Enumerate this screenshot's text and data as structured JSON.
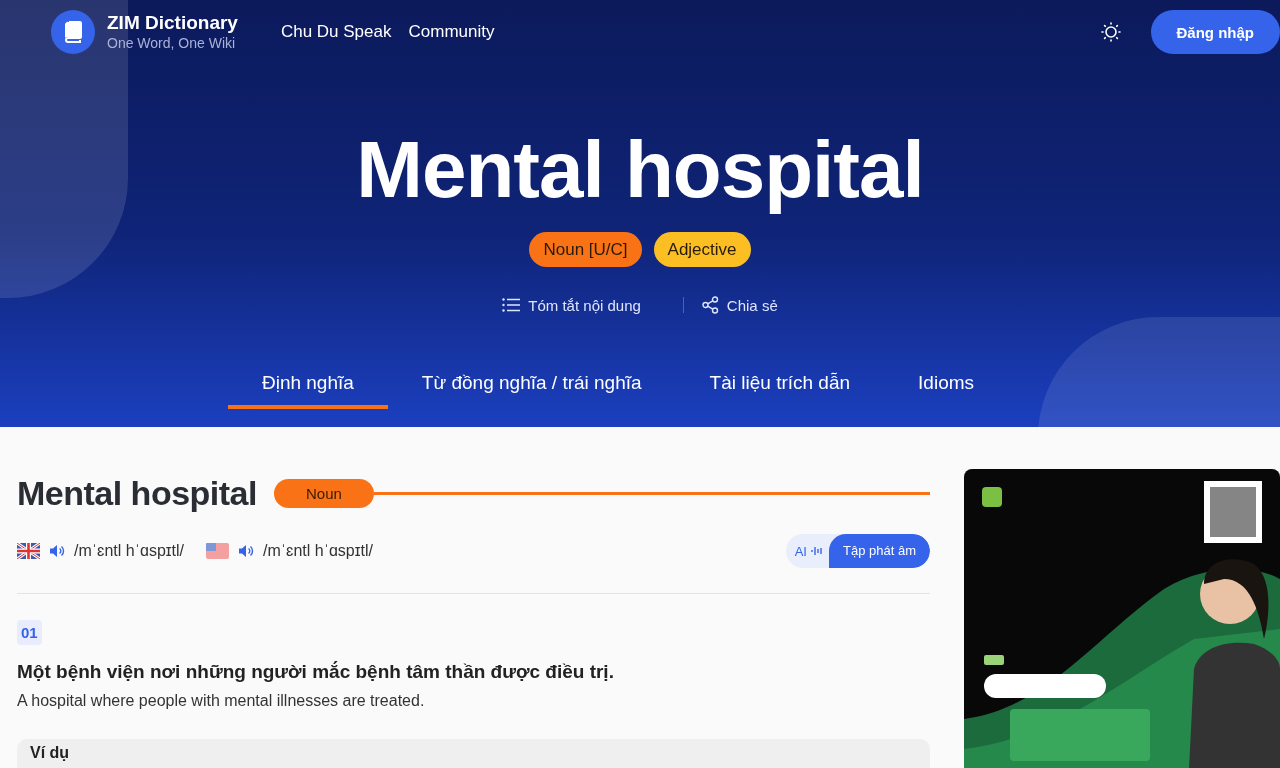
{
  "header": {
    "logo": {
      "title": "ZIM Dictionary",
      "subtitle": "One Word, One Wiki"
    },
    "nav": [
      "Chu Du Speak",
      "Community"
    ],
    "login_button": "Đăng nhập"
  },
  "hero": {
    "title": "Mental hospital",
    "tags": [
      {
        "label": "Noun [U/C]",
        "color": "#f97316"
      },
      {
        "label": "Adjective",
        "color": "#fbbf24"
      }
    ],
    "actions": [
      {
        "kind": "summary",
        "label": "Tóm tắt nội dung"
      },
      {
        "kind": "share",
        "label": "Chia sẻ"
      }
    ]
  },
  "tabs": [
    {
      "label": "Định nghĩa",
      "selected": true
    },
    {
      "label": "Từ đồng nghĩa / trái nghĩa",
      "selected": false
    },
    {
      "label": "Tài liệu trích dẫn",
      "selected": false
    },
    {
      "label": "Idioms",
      "selected": false
    }
  ],
  "entry": {
    "word": "Mental hospital",
    "part_of_speech": "Noun",
    "pronunciations": [
      {
        "kind": "uk",
        "ipa": "/mˈɛntl hˈɑspɪtl/"
      },
      {
        "kind": "us",
        "ipa": "/mˈɛntl hˈɑspɪtl/"
      }
    ],
    "practice_button": {
      "badge": "AI",
      "label": "Tập phát âm"
    },
    "senses": [
      {
        "number": "01",
        "definition_vi": "Một bệnh viện nơi những người mắc bệnh tâm thần được điều trị.",
        "definition_en": "A hospital where people with mental illnesses are treated.",
        "example_heading": "Ví dụ"
      }
    ]
  }
}
